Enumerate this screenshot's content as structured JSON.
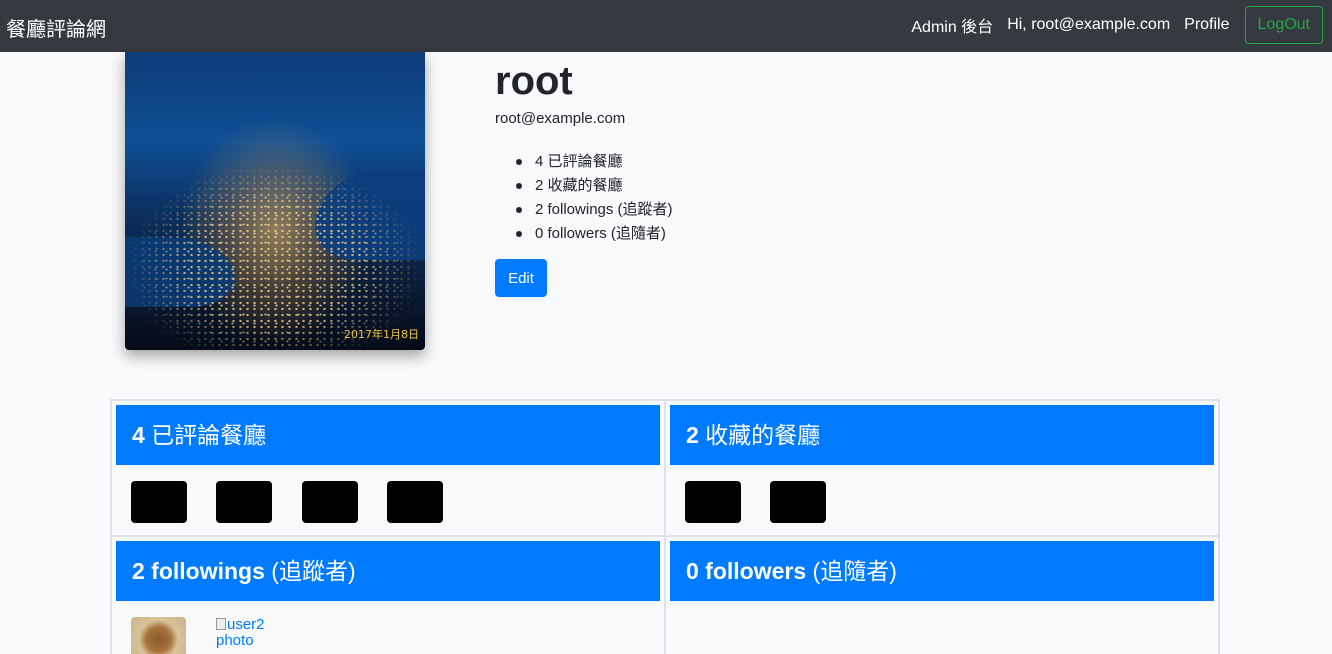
{
  "navbar": {
    "brand": "餐廳評論網",
    "admin_link": "Admin 後台",
    "greeting": "Hi, root@example.com",
    "profile_link": "Profile",
    "logout_label": "LogOut"
  },
  "profile": {
    "photo_date_stamp": "2017年1月8日",
    "username": "root",
    "email": "root@example.com",
    "stats": [
      "4 已評論餐廳",
      "2 收藏的餐廳",
      "2 followings (追蹤者)",
      "0 followers (追隨者)"
    ],
    "edit_label": "Edit"
  },
  "sections": {
    "commented": {
      "count": "4",
      "label": " 已評論餐廳",
      "thumbnail_count": 4
    },
    "favorited": {
      "count": "2",
      "label": " 收藏的餐廳",
      "thumbnail_count": 2
    },
    "followings": {
      "count": "2",
      "label": " followings",
      "suffix": " (追蹤者)",
      "broken_image_alt": "user2 photo"
    },
    "followers": {
      "count": "0",
      "label": " followers",
      "suffix": " (追隨者)"
    }
  },
  "colors": {
    "navbar_bg": "#343a40",
    "primary": "#007bff",
    "logout_outline": "#28a745",
    "page_bg": "#f8f9fa"
  }
}
